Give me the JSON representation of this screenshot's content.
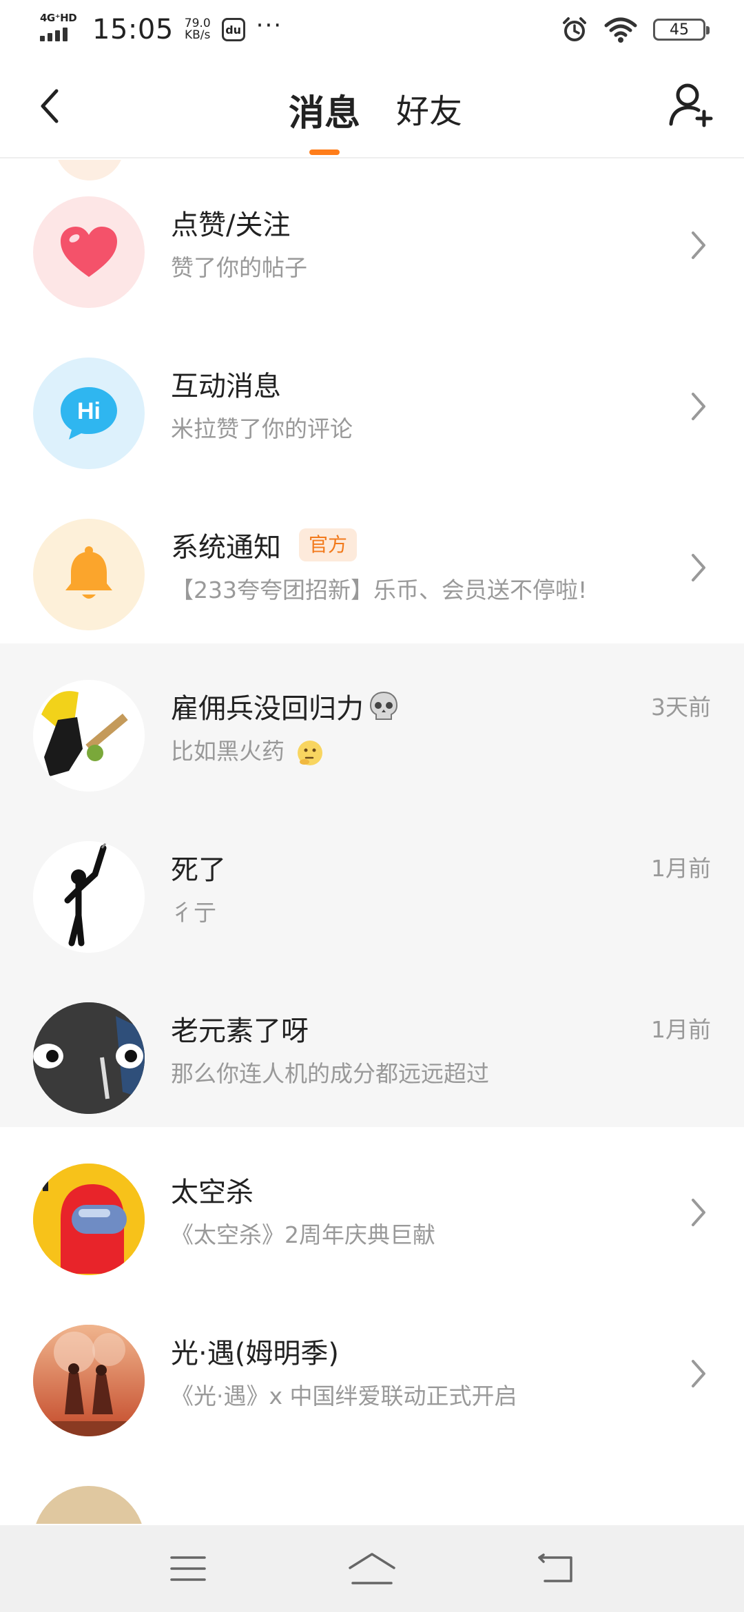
{
  "status_bar": {
    "network": "4G⁺HD",
    "time": "15:05",
    "speed_value": "79.0",
    "speed_unit": "KB/s",
    "battery": "45"
  },
  "header": {
    "tabs": [
      {
        "label": "消息",
        "active": true
      },
      {
        "label": "好友",
        "active": false
      }
    ]
  },
  "system_items": [
    {
      "title": "点赞/关注",
      "subtitle": "赞了你的帖子",
      "icon": "heart-icon",
      "bg": "#fde6e6",
      "color": "#f4526a"
    },
    {
      "title": "互动消息",
      "subtitle": "米拉赞了你的评论",
      "icon": "hi-bubble-icon",
      "bg": "#ddf1fc",
      "color": "#2fb6f0"
    },
    {
      "title": "系统通知",
      "badge": "官方",
      "subtitle": "【233夸夸团招新】乐币、会员送不停啦!",
      "icon": "bell-icon",
      "bg": "#fdf0d9",
      "color": "#fba52c"
    }
  ],
  "chats": [
    {
      "title": "雇佣兵没回归力",
      "emoji": "skull-emoji",
      "subtitle": "比如黑火药",
      "sub_emoji": "thinking-emoji",
      "time": "3天前"
    },
    {
      "title": "死了",
      "subtitle": "彳亍",
      "time": "1月前"
    },
    {
      "title": "老元素了呀",
      "subtitle": "那么你连人机的成分都远远超过",
      "time": "1月前"
    }
  ],
  "games": [
    {
      "title": "太空杀",
      "subtitle": "《太空杀》2周年庆典巨献"
    },
    {
      "title": "光·遇(姆明季)",
      "subtitle": "《光·遇》x 中国绊爱联动正式开启"
    }
  ],
  "colors": {
    "accent": "#ff7d1a",
    "gray_section": "#f6f6f6",
    "subtext": "#999999"
  }
}
